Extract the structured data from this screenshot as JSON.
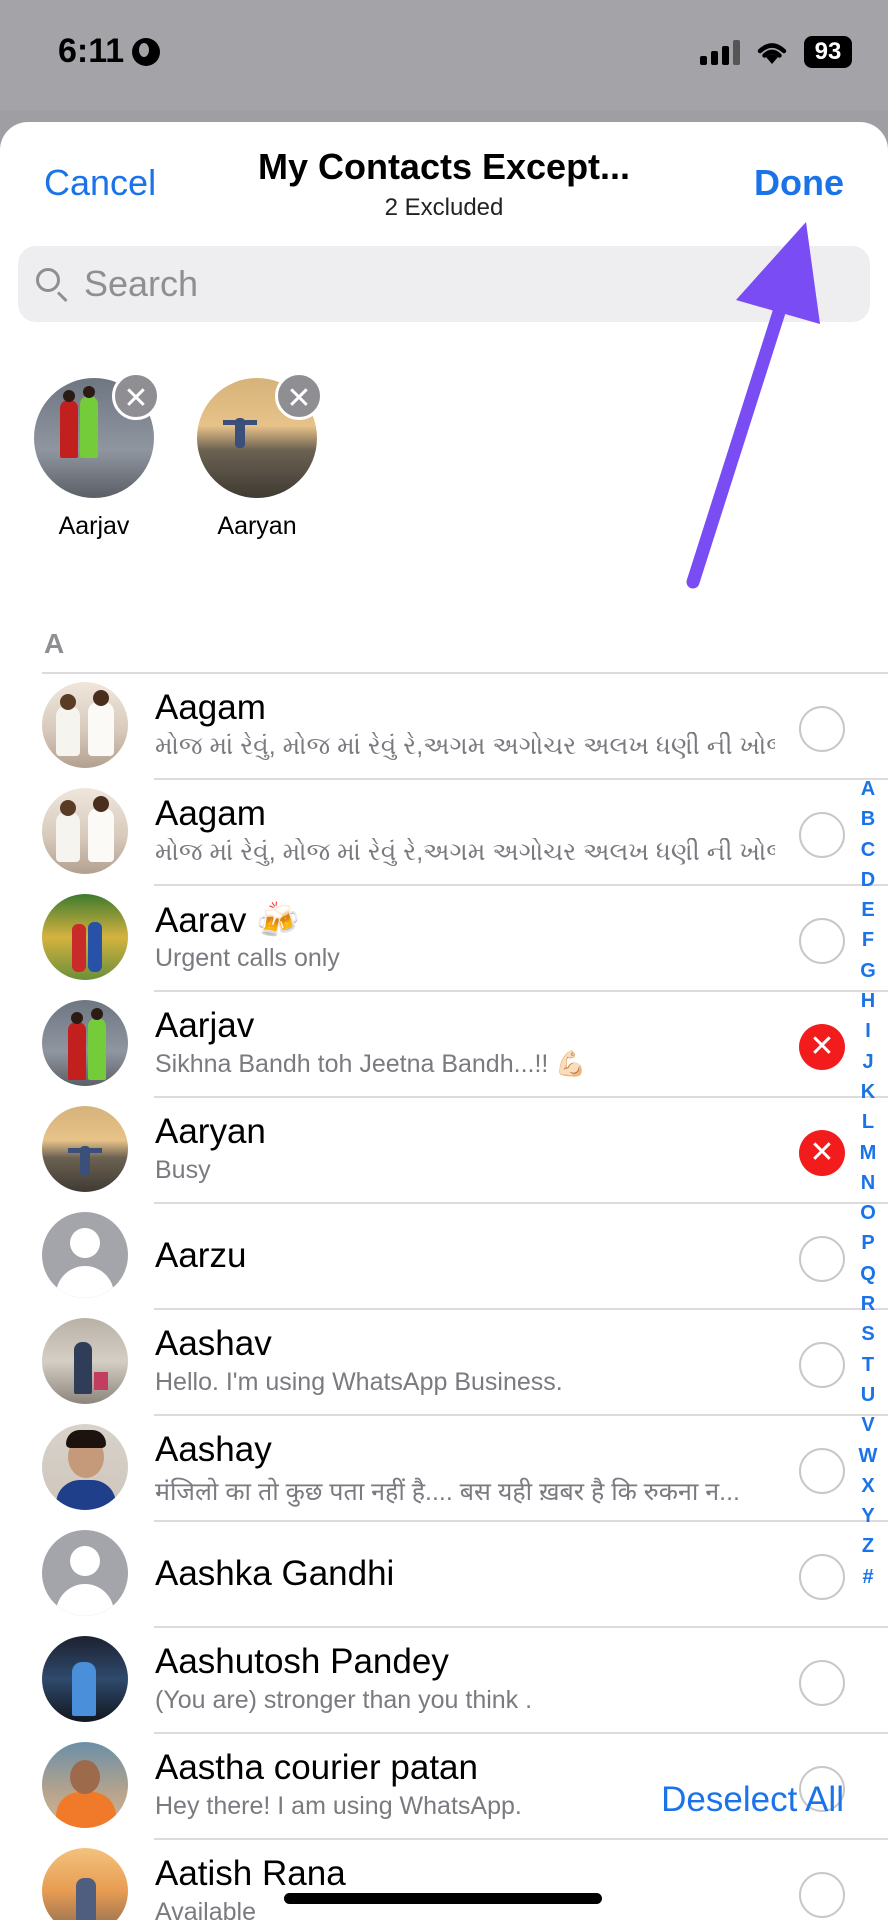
{
  "status_bar": {
    "time": "6:11",
    "battery": "93"
  },
  "nav": {
    "cancel": "Cancel",
    "title": "My Contacts Except...",
    "subtitle": "2 Excluded",
    "done": "Done"
  },
  "search": {
    "placeholder": "Search"
  },
  "excluded": [
    {
      "name": "Aarjav"
    },
    {
      "name": "Aaryan"
    }
  ],
  "section": "A",
  "contacts": [
    {
      "name": "Aagam",
      "status": "મોજ માં રેવું, મોજ માં રેવું રે,અગમ અગોચર અલખ ધણી ની ખોજ...",
      "selected": false
    },
    {
      "name": "Aagam",
      "status": "મોજ માં રેવું, મોજ માં રેવું રે,અગમ અગોચર અલખ ધણી ની ખોજ...",
      "selected": false
    },
    {
      "name": "Aarav 🍻",
      "status": "Urgent calls only",
      "selected": false
    },
    {
      "name": "Aarjav",
      "status": "Sikhna Bandh toh Jeetna Bandh...!! 💪🏻",
      "selected": true
    },
    {
      "name": "Aaryan",
      "status": "Busy",
      "selected": true
    },
    {
      "name": "Aarzu",
      "status": "",
      "selected": false
    },
    {
      "name": "Aashav",
      "status": "Hello. I'm using WhatsApp Business.",
      "selected": false
    },
    {
      "name": "Aashay",
      "status": "मंजिलो का तो कुछ पता नहीं है.... बस यही ख़बर है कि रुकना न...",
      "selected": false
    },
    {
      "name": "Aashka Gandhi",
      "status": "",
      "selected": false
    },
    {
      "name": "Aashutosh  Pandey",
      "status": "(You are) stronger than you think .",
      "selected": false
    },
    {
      "name": "Aastha courier patan",
      "status": "Hey there! I am using WhatsApp.",
      "selected": false
    },
    {
      "name": "Aatish Rana",
      "status": "Available",
      "selected": false
    }
  ],
  "index_letters": [
    "A",
    "B",
    "C",
    "D",
    "E",
    "F",
    "G",
    "H",
    "I",
    "J",
    "K",
    "L",
    "M",
    "N",
    "O",
    "P",
    "Q",
    "R",
    "S",
    "T",
    "U",
    "V",
    "W",
    "X",
    "Y",
    "Z",
    "#"
  ],
  "deselect_all": "Deselect All",
  "icons": {
    "remove": "✕",
    "selected_mark": "✕"
  },
  "colors": {
    "accent": "#1a73e8",
    "selected": "#f21c1c",
    "arrow": "#7a4cf4"
  }
}
